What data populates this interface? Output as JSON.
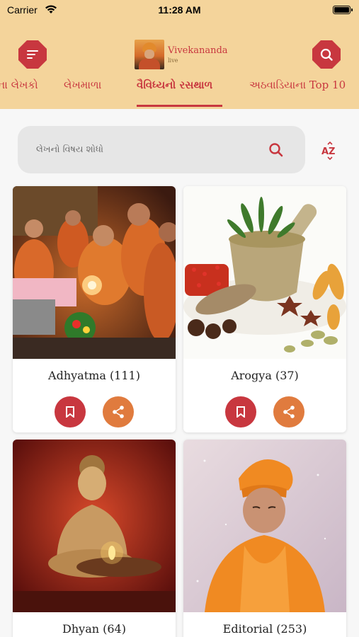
{
  "status_bar": {
    "carrier": "Carrier",
    "time": "11:28 AM"
  },
  "header": {
    "logo_title": "Vivekananda",
    "logo_subtitle": "live",
    "menu_icon": "menu-lines-icon",
    "search_icon": "search-icon"
  },
  "tabs": [
    {
      "label": "ના લેખકો"
    },
    {
      "label": "લેખમાળા"
    },
    {
      "label": "વૈવિધ્યનો રસથાળ",
      "active": true
    },
    {
      "label": "અઠવાડિયાના Top 10"
    }
  ],
  "search": {
    "placeholder": "લેખનો વિષય શોધો"
  },
  "sort": {
    "label": "AZ"
  },
  "categories": [
    {
      "title": "Adhyatma (111)"
    },
    {
      "title": "Arogya (37)"
    },
    {
      "title": "Dhyan (64)"
    },
    {
      "title": "Editorial (253)"
    }
  ],
  "colors": {
    "header_bg": "#f4d49b",
    "primary_red": "#c8373f",
    "share_orange": "#e07b3e"
  }
}
